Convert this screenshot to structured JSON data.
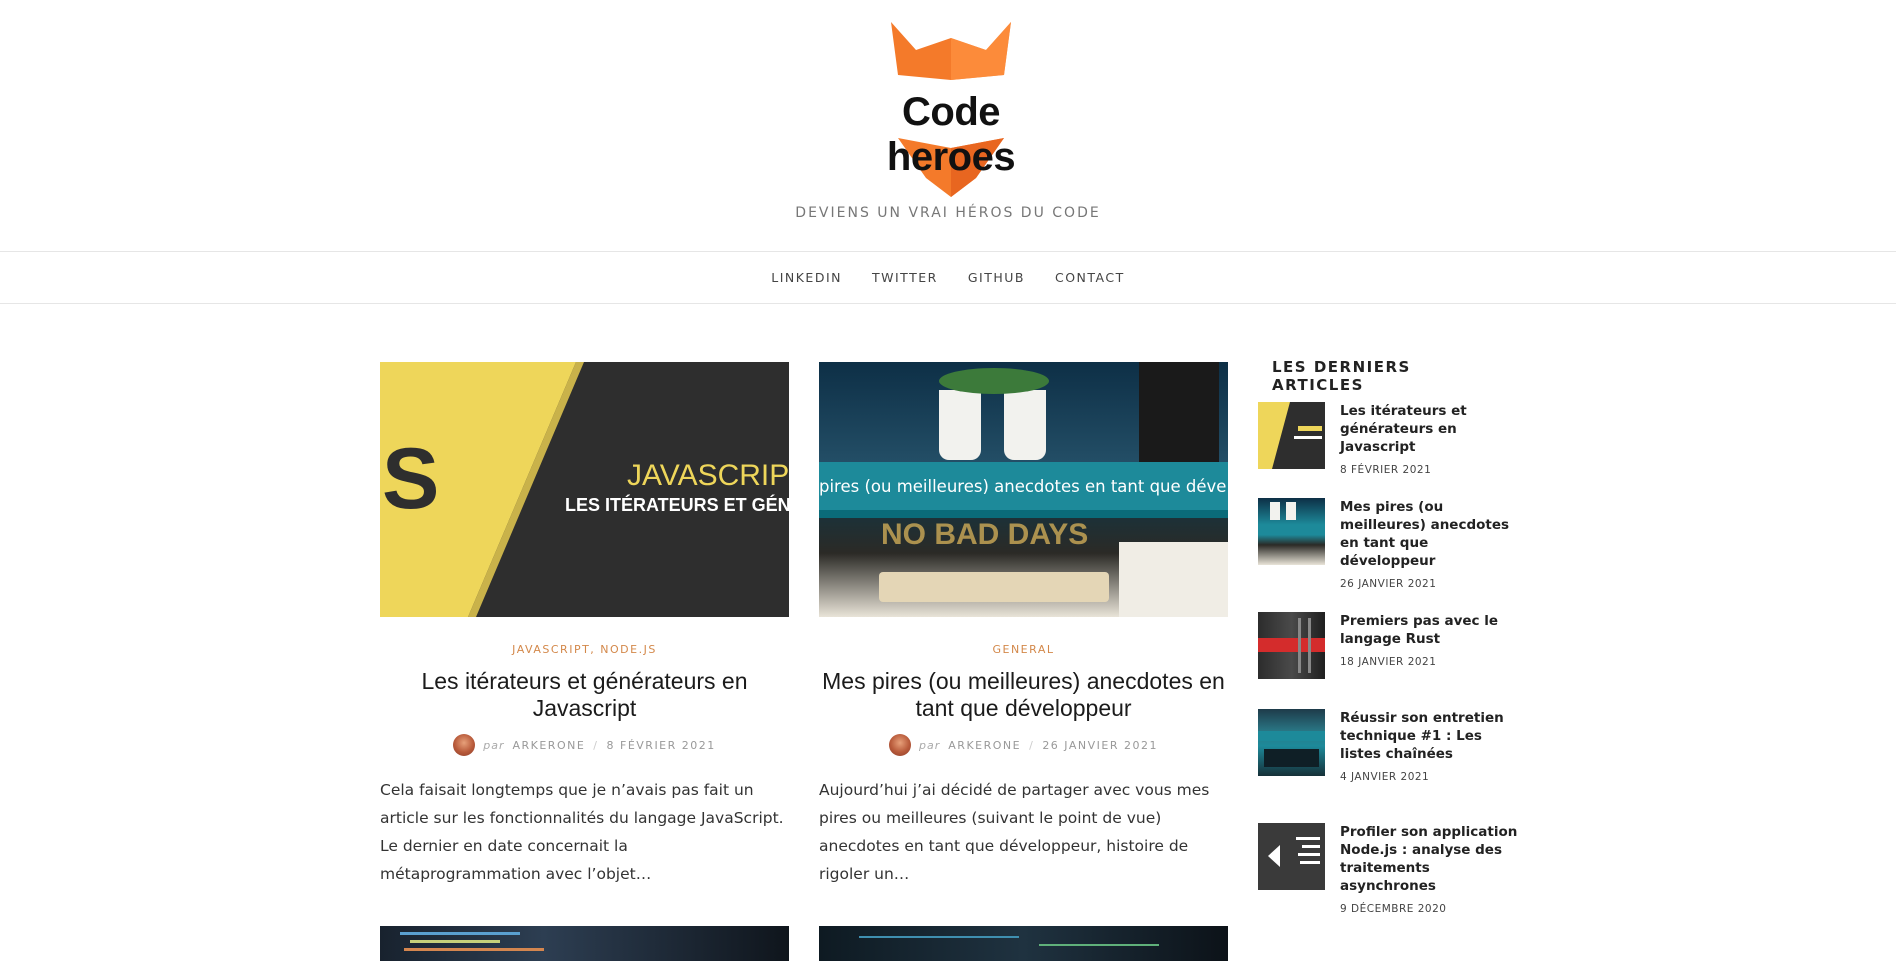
{
  "site": {
    "logo_text": "Code heroes",
    "tagline": "DEVIENS UN VRAI HÉROS DU CODE"
  },
  "nav": [
    "LINKEDIN",
    "TWITTER",
    "GITHUB",
    "CONTACT"
  ],
  "posts": [
    {
      "thumb_word": "JAVASCRIPT",
      "thumb_sub": "LES ITÉRATEURS ET GÉNÉ",
      "thumb_letter": "S",
      "categories": "JAVASCRIPT, NODE.JS",
      "title": "Les itérateurs et générateurs en Javascript",
      "by": "par",
      "author": "ARKERONE",
      "date": "8 FÉVRIER 2021",
      "excerpt": "Cela faisait longtemps que je n’avais pas fait un article sur les fonctionnalités du langage JavaScript. Le dernier en date concernait la métaprogrammation avec l’objet…"
    },
    {
      "thumb_banner": "pires (ou meilleures) anecdotes en tant que développ",
      "thumb_sign": "NO BAD DAYS",
      "categories": "GENERAL",
      "title": "Mes pires (ou meilleures) anecdotes en tant que développeur",
      "by": "par",
      "author": "ARKERONE",
      "date": "26 JANVIER 2021",
      "excerpt": "Aujourd’hui j’ai décidé de partager avec vous mes pires ou meilleures (suivant le point de vue) anecdotes en tant que développeur, histoire de rigoler un…"
    }
  ],
  "sidebar": {
    "title": "LES DERNIERS ARTICLES",
    "items": [
      {
        "title": "Les itérateurs et générateurs en Javascript",
        "date": "8 FÉVRIER 2021"
      },
      {
        "title": "Mes pires (ou meilleures) anecdotes en tant que développeur",
        "date": "26 JANVIER 2021"
      },
      {
        "title": "Premiers pas avec le langage Rust",
        "date": "18 JANVIER 2021"
      },
      {
        "title": "Réussir son entretien technique #1 : Les listes chaînées",
        "date": "4 JANVIER 2021"
      },
      {
        "title": "Profiler son application Node.js : analyse des traitements asynchrones",
        "date": "9 DÉCEMBRE 2020"
      }
    ]
  },
  "colors": {
    "accent_orange": "#d3884a",
    "logo_orange": "#f47a2a",
    "js_yellow": "#eed65a"
  }
}
